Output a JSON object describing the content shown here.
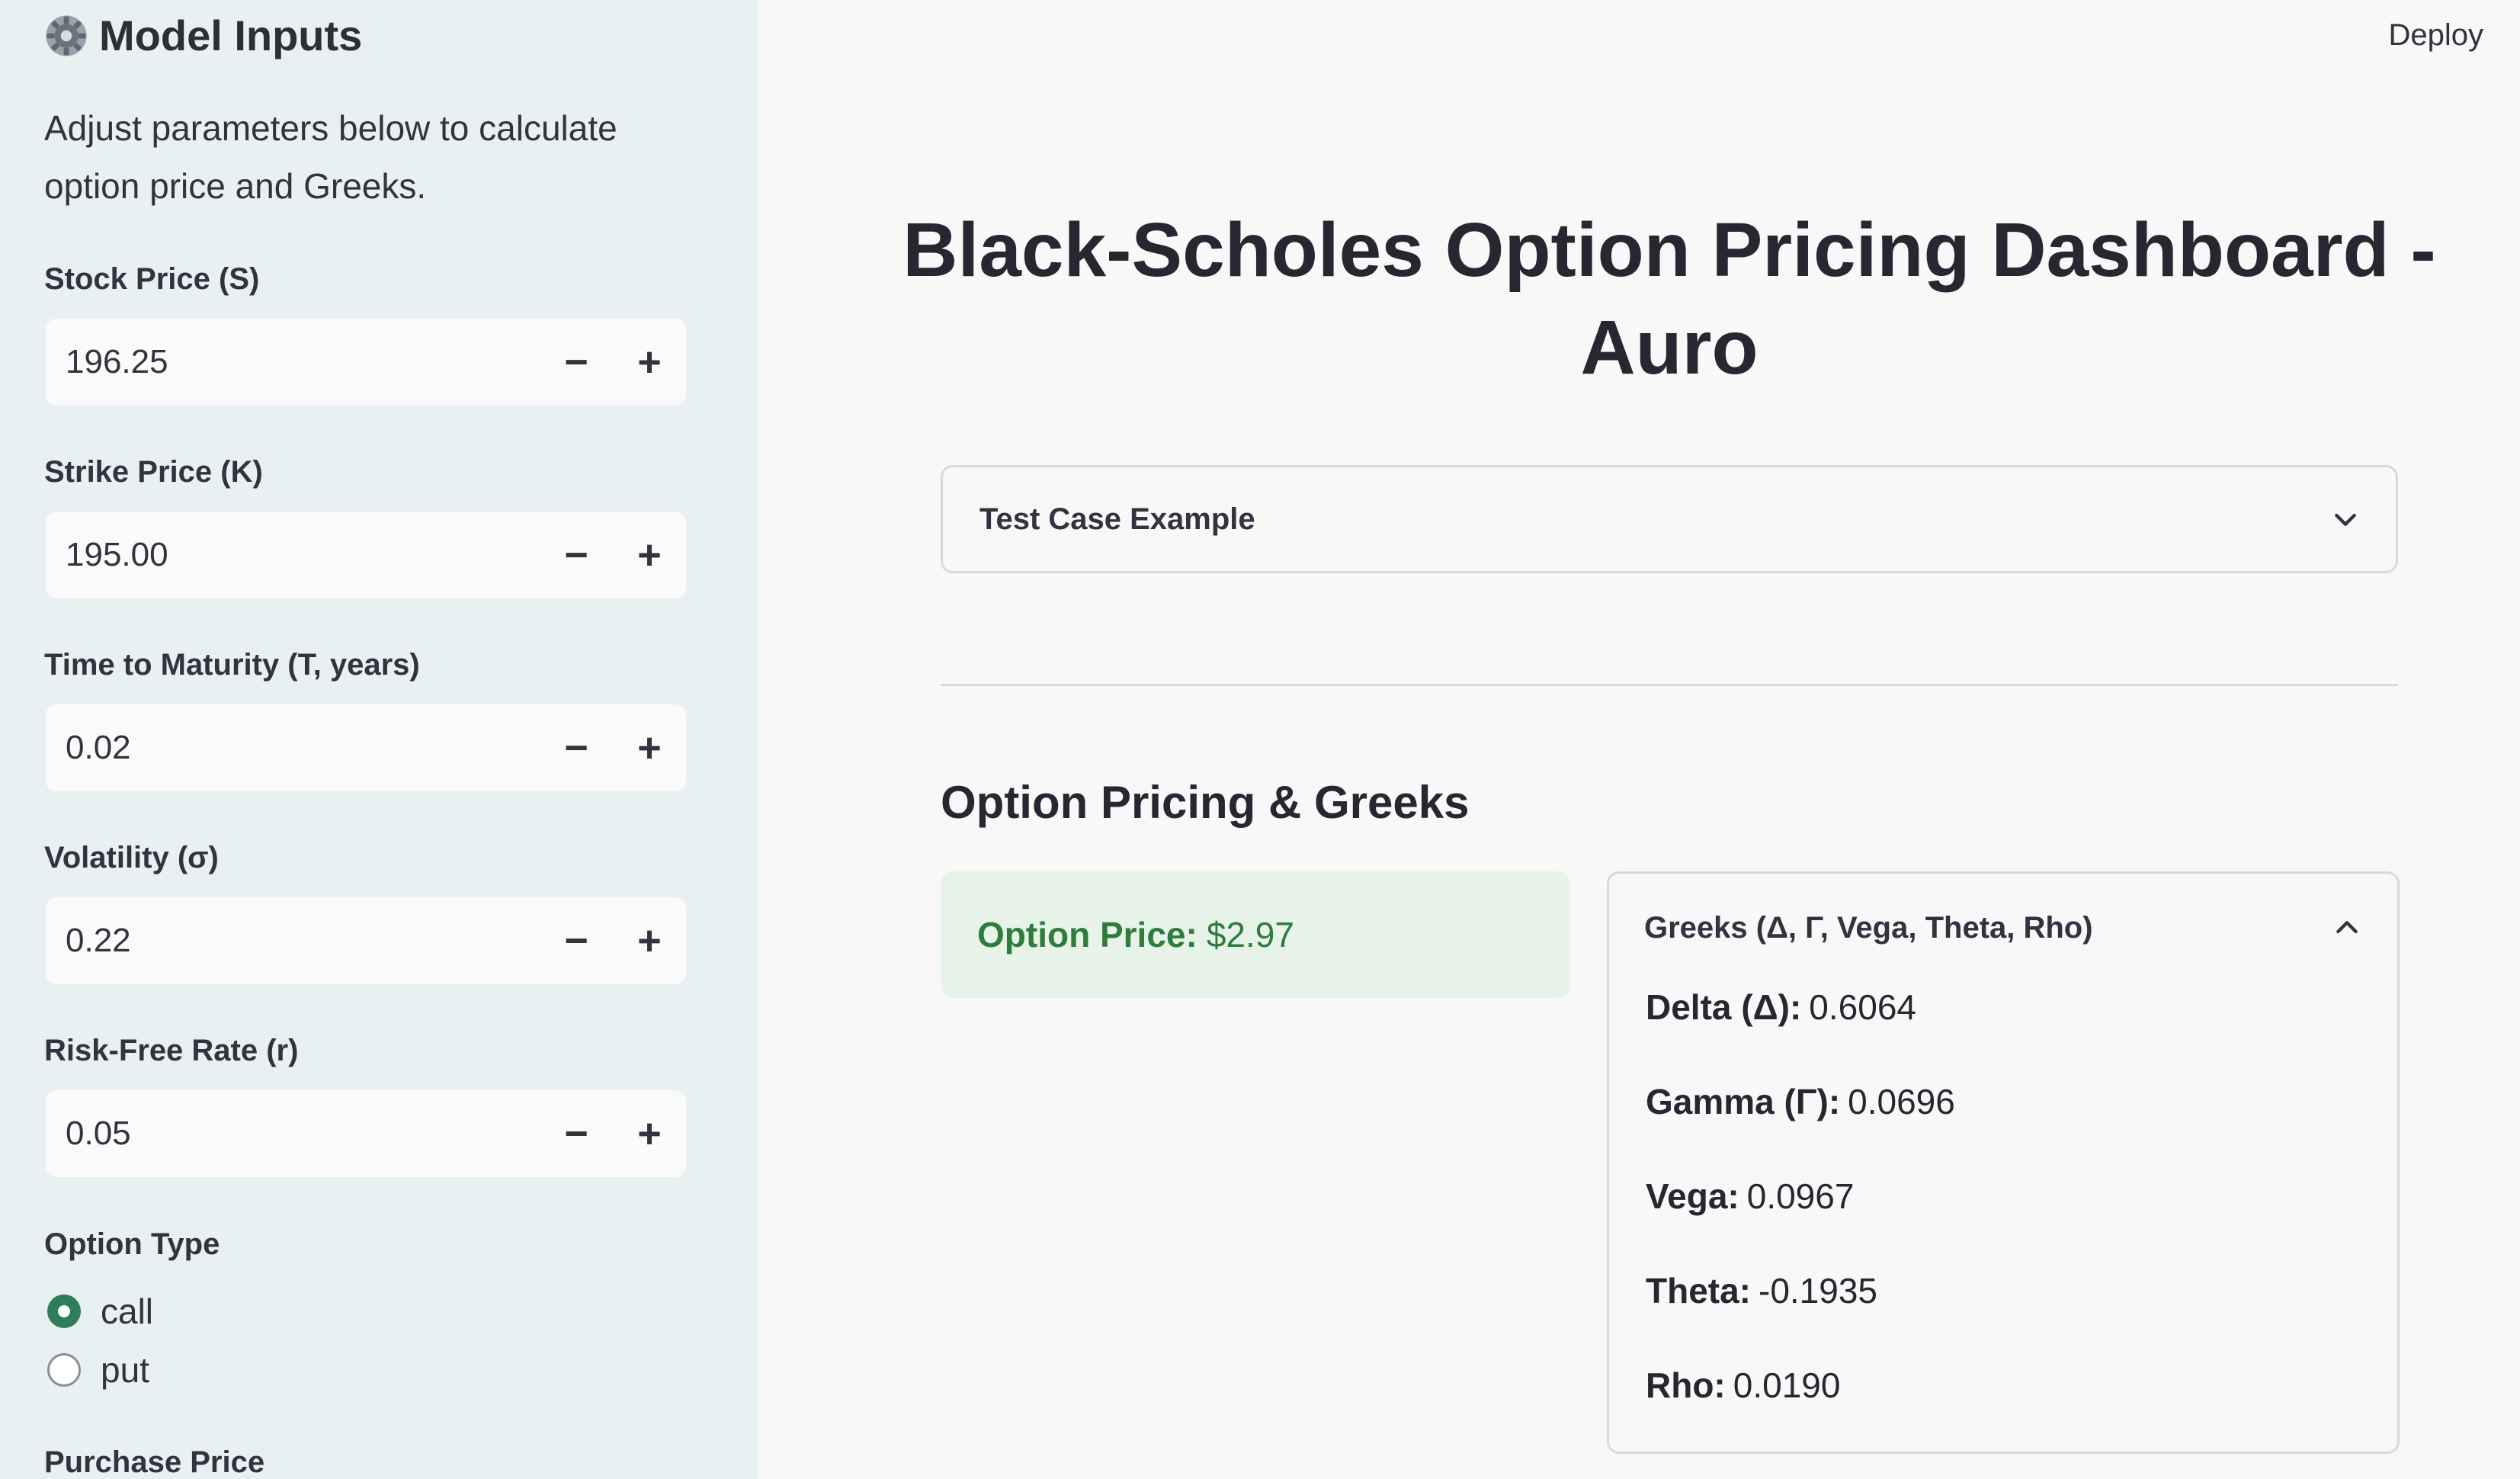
{
  "sidebar": {
    "title": "Model Inputs",
    "description": "Adjust parameters below to calculate option price and Greeks.",
    "fields": [
      {
        "label": "Stock Price (S)",
        "value": "196.25"
      },
      {
        "label": "Strike Price (K)",
        "value": "195.00"
      },
      {
        "label": "Time to Maturity (T, years)",
        "value": "0.02"
      },
      {
        "label": "Volatility (σ)",
        "value": "0.22"
      },
      {
        "label": "Risk-Free Rate (r)",
        "value": "0.05"
      }
    ],
    "stepper_minus": "−",
    "stepper_plus": "+",
    "option_type": {
      "label": "Option Type",
      "options": [
        "call",
        "put"
      ],
      "selected": "call"
    },
    "purchase_price_label": "Purchase Price"
  },
  "header": {
    "deploy_label": "Deploy"
  },
  "main": {
    "title": "Black-Scholes Option Pricing Dashboard - Auro",
    "test_case_label": "Test Case Example",
    "section_title": "Option Pricing & Greeks",
    "option_price": {
      "label": "Option Price:",
      "value": "$2.97"
    },
    "greeks": {
      "header": "Greeks (Δ, Γ, Vega, Theta, Rho)",
      "items": [
        {
          "label": "Delta (Δ):",
          "value": "0.6064"
        },
        {
          "label": "Gamma (Γ):",
          "value": "0.0696"
        },
        {
          "label": "Vega:",
          "value": "0.0967"
        },
        {
          "label": "Theta:",
          "value": "-0.1935"
        },
        {
          "label": "Rho:",
          "value": "0.0190"
        }
      ]
    }
  },
  "colors": {
    "sidebar_bg": "#e8f0f2",
    "accent_green": "#2e7d5b",
    "success_bg": "#e7f2e9",
    "success_text": "#2e7d3c"
  },
  "icons": {
    "sidebar_title": "gear-icon",
    "expander_collapsed": "chevron-down-icon",
    "expander_expanded": "chevron-up-icon"
  }
}
